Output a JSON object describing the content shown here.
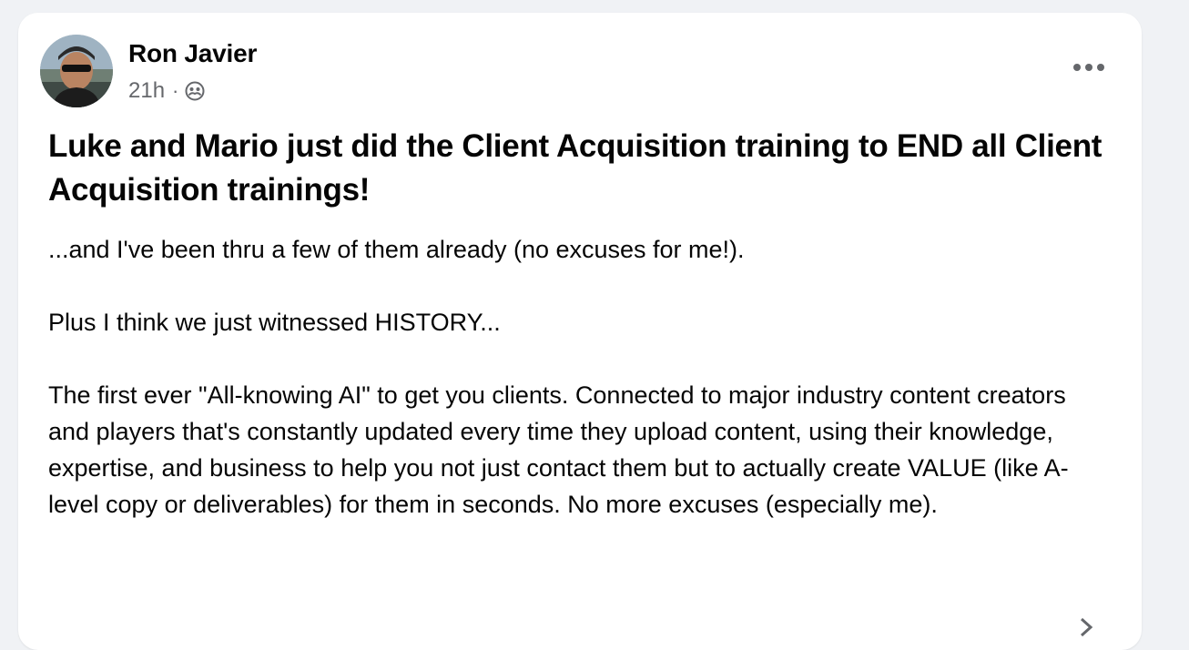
{
  "post": {
    "author": "Ron Javier",
    "timestamp": "21h",
    "separator": "·",
    "audience_icon": "friends-audience-icon",
    "more_icon": "more-options-icon",
    "headline": "Luke and Mario just did the Client Acquisition training to END all Client Acquisition trainings!",
    "paragraphs": [
      "...and I've been thru a few of them already (no excuses for me!).",
      "Plus I think we just witnessed HISTORY...",
      "The first ever \"All-knowing AI\" to get you clients. Connected to major industry content creators and players that's constantly updated every time they upload content, using their knowledge, expertise, and business to help you not just contact them but to actually create VALUE (like A-level copy or deliverables) for them in seconds. No more excuses (especially me)."
    ]
  },
  "colors": {
    "page_background": "#f0f2f5",
    "card_background": "#ffffff",
    "primary_text": "#050505",
    "secondary_text": "#65676b"
  }
}
